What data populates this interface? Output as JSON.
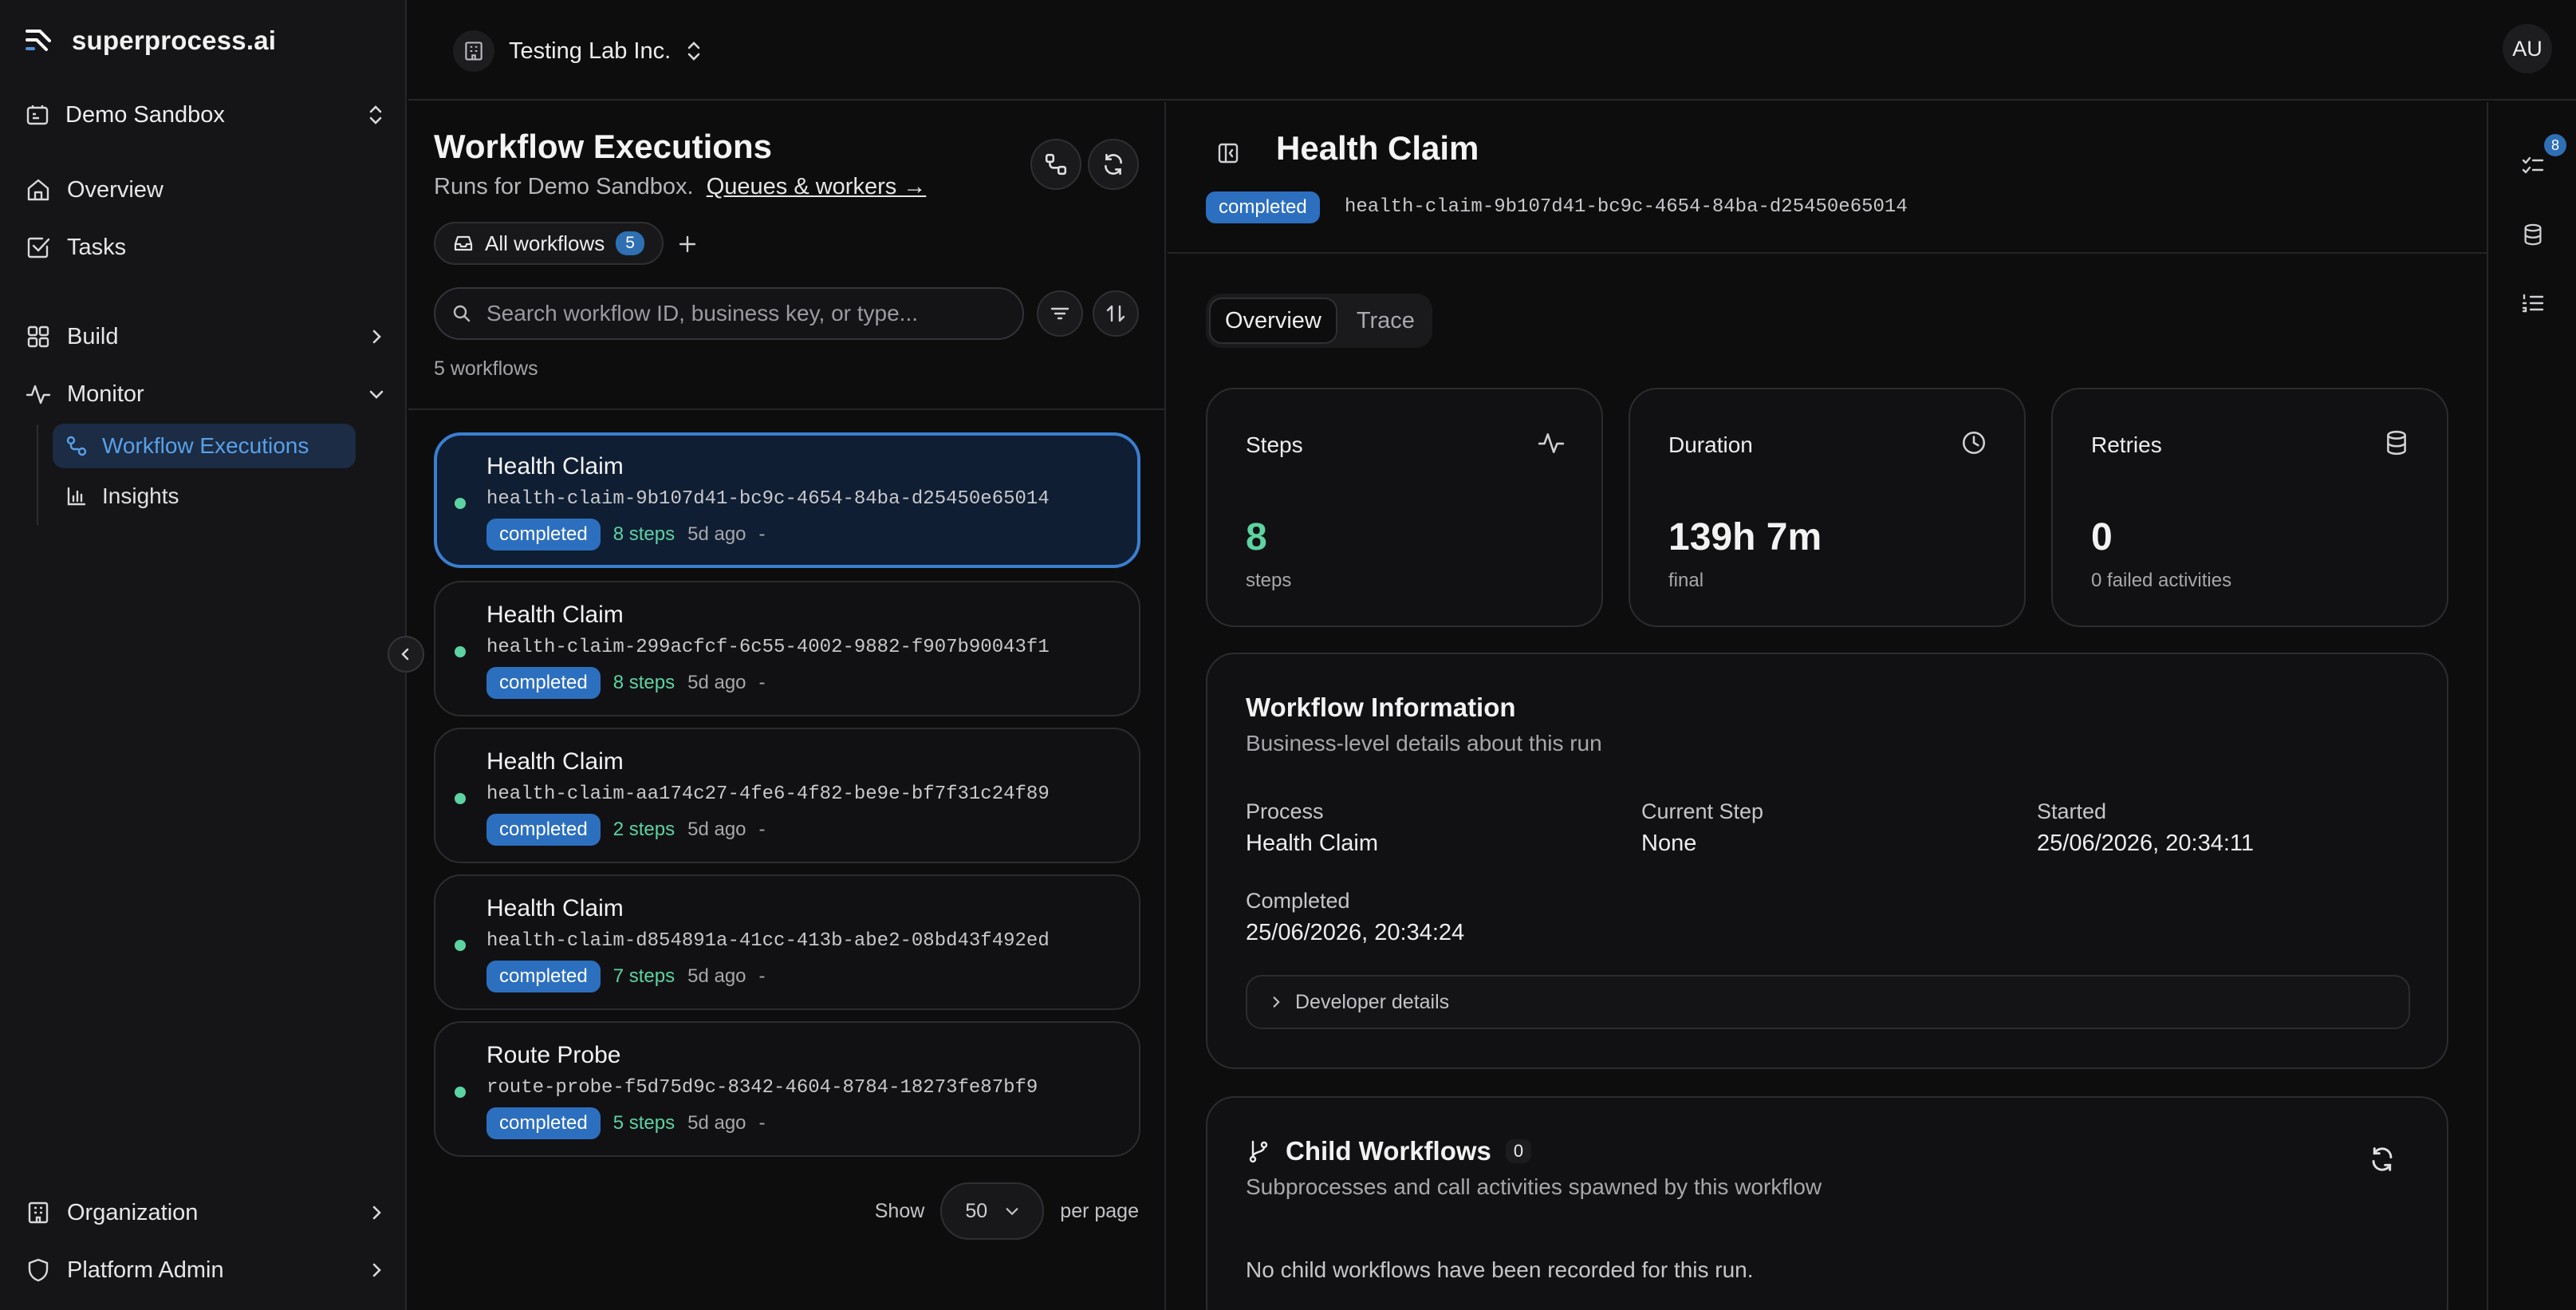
{
  "brand": {
    "name": "superprocess.ai"
  },
  "sidebar": {
    "environment": "Demo Sandbox",
    "nav": {
      "overview": "Overview",
      "tasks": "Tasks",
      "build": "Build",
      "monitor": "Monitor",
      "workflow_executions": "Workflow Executions",
      "insights": "Insights",
      "organization": "Organization",
      "platform_admin": "Platform Admin"
    }
  },
  "topbar": {
    "org_name": "Testing Lab Inc.",
    "avatar_initials": "AU"
  },
  "list": {
    "title": "Workflow Executions",
    "subtitle": "Runs for Demo Sandbox.",
    "queues_link": "Queues & workers →",
    "filter_chip": {
      "label": "All workflows",
      "count": "5"
    },
    "search_placeholder": "Search workflow ID, business key, or type...",
    "count_text": "5 workflows",
    "items": [
      {
        "title": "Health Claim",
        "id": "health-claim-9b107d41-bc9c-4654-84ba-d25450e65014",
        "status": "completed",
        "steps": "8 steps",
        "age": "5d ago",
        "extra": "-"
      },
      {
        "title": "Health Claim",
        "id": "health-claim-299acfcf-6c55-4002-9882-f907b90043f1",
        "status": "completed",
        "steps": "8 steps",
        "age": "5d ago",
        "extra": "-"
      },
      {
        "title": "Health Claim",
        "id": "health-claim-aa174c27-4fe6-4f82-be9e-bf7f31c24f89",
        "status": "completed",
        "steps": "2 steps",
        "age": "5d ago",
        "extra": "-"
      },
      {
        "title": "Health Claim",
        "id": "health-claim-d854891a-41cc-413b-abe2-08bd43f492ed",
        "status": "completed",
        "steps": "7 steps",
        "age": "5d ago",
        "extra": "-"
      },
      {
        "title": "Route Probe",
        "id": "route-probe-f5d75d9c-8342-4604-8784-18273fe87bf9",
        "status": "completed",
        "steps": "5 steps",
        "age": "5d ago",
        "extra": "-"
      }
    ],
    "pager": {
      "show": "Show",
      "value": "50",
      "per_page": "per page"
    }
  },
  "detail": {
    "title": "Health Claim",
    "status": "completed",
    "id": "health-claim-9b107d41-bc9c-4654-84ba-d25450e65014",
    "tabs": [
      "Overview",
      "Trace"
    ],
    "stats": {
      "steps": {
        "label": "Steps",
        "value": "8",
        "note": "steps"
      },
      "duration": {
        "label": "Duration",
        "value": "139h 7m",
        "note": "final"
      },
      "retries": {
        "label": "Retries",
        "value": "0",
        "note": "0 failed activities"
      }
    },
    "info": {
      "title": "Workflow Information",
      "subtitle": "Business-level details about this run",
      "process_label": "Process",
      "process_value": "Health Claim",
      "current_step_label": "Current Step",
      "current_step_value": "None",
      "started_label": "Started",
      "started_value": "25/06/2026, 20:34:11",
      "completed_label": "Completed",
      "completed_value": "25/06/2026, 20:34:24",
      "developer_details": "Developer details"
    },
    "child": {
      "title": "Child Workflows",
      "count": "0",
      "subtitle": "Subprocesses and call activities spawned by this workflow",
      "empty": "No child workflows have been recorded for this run."
    }
  },
  "rail": {
    "tasks_badge": "8"
  },
  "colors": {
    "accent": "#2c6fbf",
    "success": "#5dd3a2",
    "background": "#0d0d0e"
  }
}
